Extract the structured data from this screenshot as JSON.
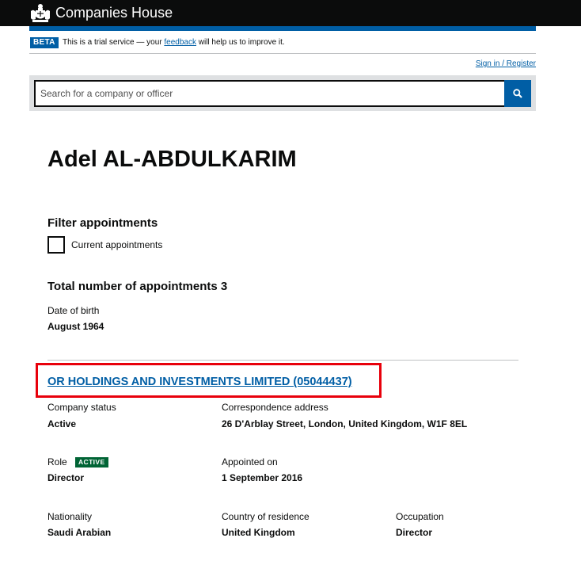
{
  "header": {
    "brand": "Companies House",
    "crest_icon": "royal-crest-icon"
  },
  "beta": {
    "badge": "BETA",
    "text_before": "This is a trial service — your",
    "link": "feedback",
    "text_after": "will help us to improve it."
  },
  "signin": "Sign in / Register",
  "search": {
    "placeholder": "Search for a company or officer",
    "button_icon": "search-icon"
  },
  "officer": {
    "name": "Adel AL-ABDULKARIM",
    "filter_title": "Filter appointments",
    "filter_option": "Current appointments",
    "filter_checked": false,
    "total": "Total number of appointments 3",
    "dob_label": "Date of birth",
    "dob_value": "August 1964"
  },
  "appointment": {
    "company": "OR HOLDINGS AND INVESTMENTS LIMITED (05044437)",
    "company_status_label": "Company status",
    "company_status": "Active",
    "address_label": "Correspondence address",
    "address": "26 D'Arblay Street, London, United Kingdom, W1F 8EL",
    "role_label": "Role",
    "role_tag": "ACTIVE",
    "role": "Director",
    "appointed_label": "Appointed on",
    "appointed": "1 September 2016",
    "nationality_label": "Nationality",
    "nationality": "Saudi Arabian",
    "residence_label": "Country of residence",
    "residence": "United Kingdom",
    "occupation_label": "Occupation",
    "occupation": "Director"
  },
  "colors": {
    "brand_blue": "#005ea5",
    "header_black": "#0b0c0c",
    "active_green": "#006435",
    "highlight_red": "#e8000b"
  }
}
